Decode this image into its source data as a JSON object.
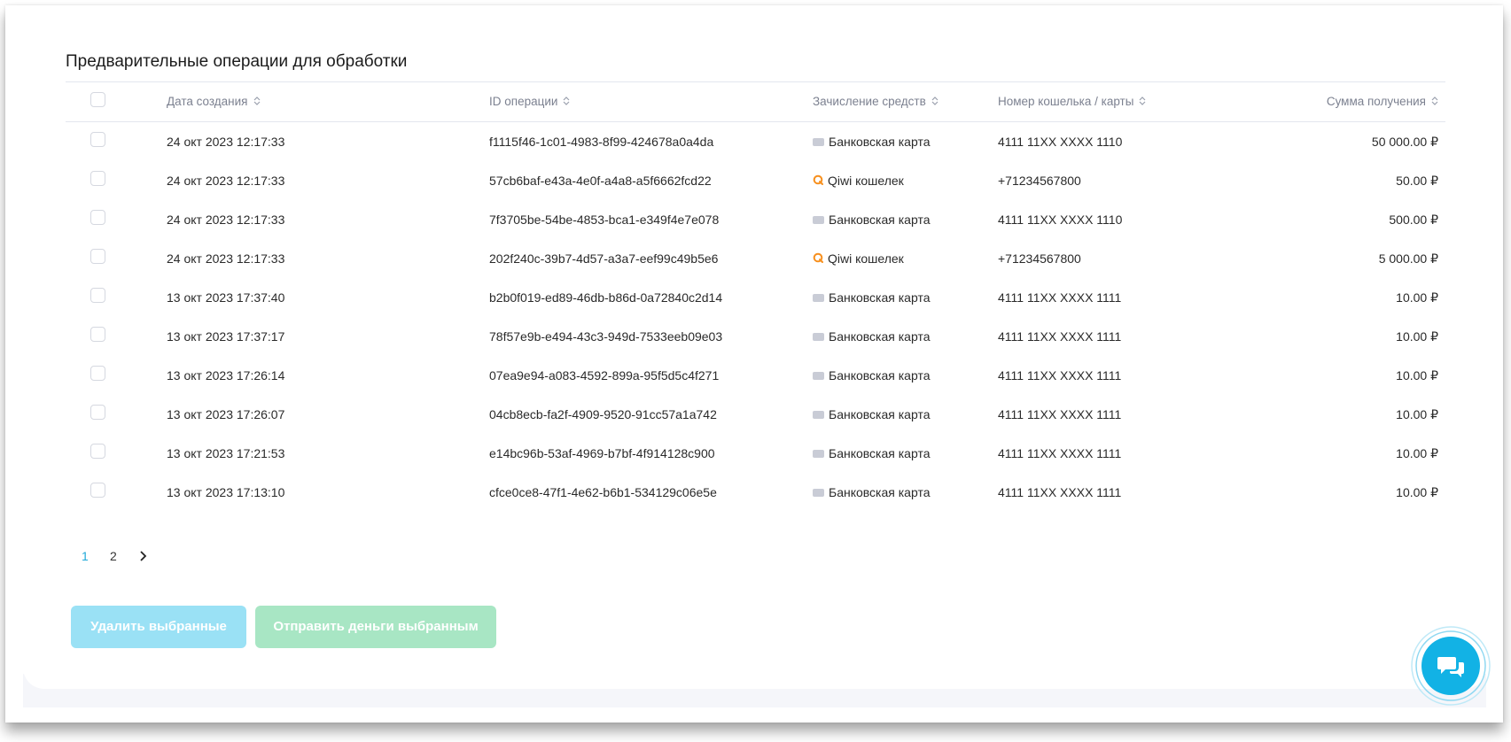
{
  "title": "Предварительные операции для обработки",
  "columns": {
    "date": "Дата создания",
    "id": "ID операции",
    "method": "Зачисление средств",
    "wallet": "Номер кошелька / карты",
    "amount": "Сумма получения"
  },
  "rows": [
    {
      "date": "24 окт 2023 12:17:33",
      "id": "f1115f46-1c01-4983-8f99-424678a0a4da",
      "method": "Банковская карта",
      "method_icon": "card-icon",
      "wallet": "4111 11XX XXXX 1110",
      "amount": "50 000.00 ₽"
    },
    {
      "date": "24 окт 2023 12:17:33",
      "id": "57cb6baf-e43a-4e0f-a4a8-a5f6662fcd22",
      "method": "Qiwi кошелек",
      "method_icon": "qiwi-icon",
      "wallet": "+71234567800",
      "amount": "50.00 ₽"
    },
    {
      "date": "24 окт 2023 12:17:33",
      "id": "7f3705be-54be-4853-bca1-e349f4e7e078",
      "method": "Банковская карта",
      "method_icon": "card-icon",
      "wallet": "4111 11XX XXXX 1110",
      "amount": "500.00 ₽"
    },
    {
      "date": "24 окт 2023 12:17:33",
      "id": "202f240c-39b7-4d57-a3a7-eef99c49b5e6",
      "method": "Qiwi кошелек",
      "method_icon": "qiwi-icon",
      "wallet": "+71234567800",
      "amount": "5 000.00 ₽"
    },
    {
      "date": "13 окт 2023 17:37:40",
      "id": "b2b0f019-ed89-46db-b86d-0a72840c2d14",
      "method": "Банковская карта",
      "method_icon": "card-icon",
      "wallet": "4111 11XX XXXX 1111",
      "amount": "10.00 ₽"
    },
    {
      "date": "13 окт 2023 17:37:17",
      "id": "78f57e9b-e494-43c3-949d-7533eeb09e03",
      "method": "Банковская карта",
      "method_icon": "card-icon",
      "wallet": "4111 11XX XXXX 1111",
      "amount": "10.00 ₽"
    },
    {
      "date": "13 окт 2023 17:26:14",
      "id": "07ea9e94-a083-4592-899a-95f5d5c4f271",
      "method": "Банковская карта",
      "method_icon": "card-icon",
      "wallet": "4111 11XX XXXX 1111",
      "amount": "10.00 ₽"
    },
    {
      "date": "13 окт 2023 17:26:07",
      "id": "04cb8ecb-fa2f-4909-9520-91cc57a1a742",
      "method": "Банковская карта",
      "method_icon": "card-icon",
      "wallet": "4111 11XX XXXX 1111",
      "amount": "10.00 ₽"
    },
    {
      "date": "13 окт 2023 17:21:53",
      "id": "e14bc96b-53af-4969-b7bf-4f914128c900",
      "method": "Банковская карта",
      "method_icon": "card-icon",
      "wallet": "4111 11XX XXXX 1111",
      "amount": "10.00 ₽"
    },
    {
      "date": "13 окт 2023 17:13:10",
      "id": "cfce0ce8-47f1-4e62-b6b1-534129c06e5e",
      "method": "Банковская карта",
      "method_icon": "card-icon",
      "wallet": "4111 11XX XXXX 1111",
      "amount": "10.00 ₽"
    }
  ],
  "pagination": {
    "pages": [
      "1",
      "2"
    ],
    "current": "1",
    "next_icon": "chevron-right-icon"
  },
  "actions": {
    "delete_label": "Удалить выбранные",
    "send_label": "Отправить деньги выбранным"
  },
  "chat": {
    "icon": "chat-icon"
  },
  "colors": {
    "accent": "#1fa9d9",
    "delete_btn": "#9ae1f5",
    "send_btn": "#a8e6c4",
    "qiwi": "#f7901e",
    "chat": "#12b2e5"
  }
}
